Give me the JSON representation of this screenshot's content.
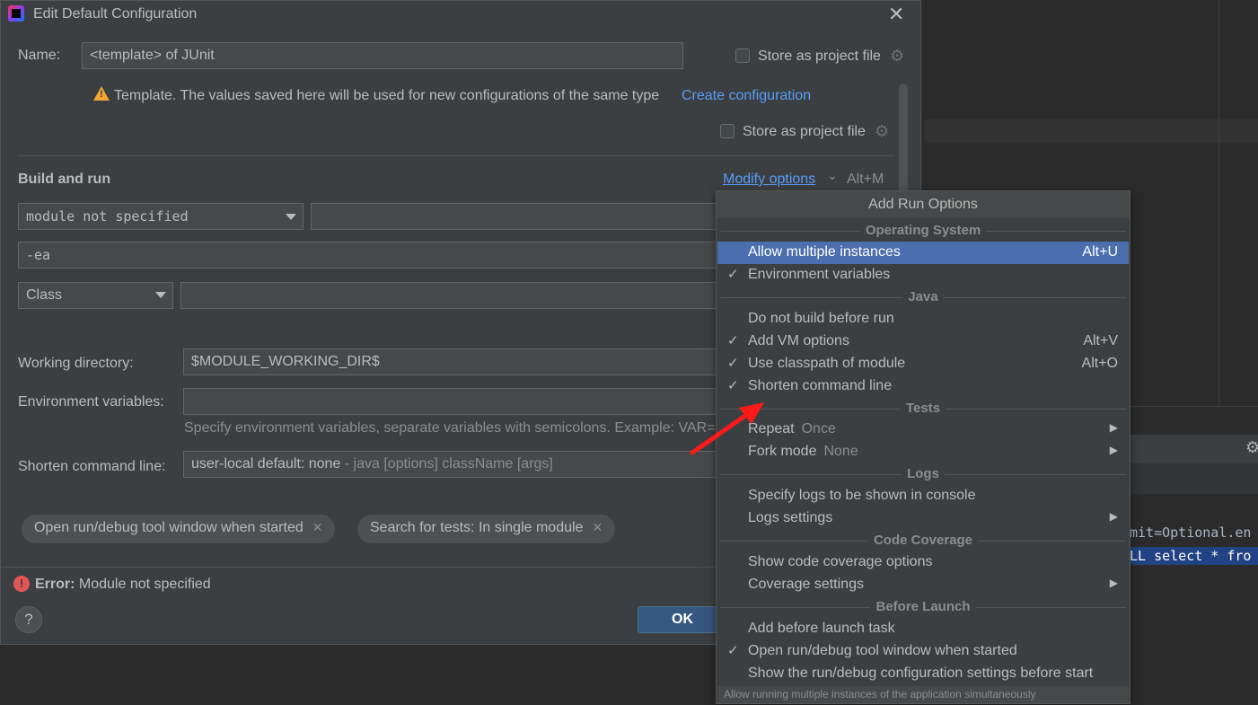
{
  "dialog": {
    "title": "Edit Default Configuration",
    "name_label": "Name:",
    "name_value": "<template> of JUnit",
    "store_label": "Store as project file",
    "warning_text": "Template. The values saved here will be used for new configurations of the same type",
    "create_link": "Create configuration",
    "store_label_2": "Store as project file",
    "section_title": "Build and run",
    "modify_options": "Modify options",
    "modify_shortcut": "Alt+M",
    "module_select": "module not specified",
    "vm_options": "-ea",
    "class_select": "Class",
    "working_dir_label": "Working directory:",
    "working_dir_value": "$MODULE_WORKING_DIR$",
    "env_label": "Environment variables:",
    "env_hint": "Specify environment variables, separate variables with semicolons. Example: VAR=",
    "shorten_label": "Shorten command line:",
    "shorten_value": "user-local default: none",
    "shorten_hint": " - java [options] className [args]",
    "chips": [
      "Open run/debug tool window when started",
      "Search for tests: In single module"
    ],
    "error_label": "Error:",
    "error_text": "Module not specified",
    "help": "?",
    "ok": "OK"
  },
  "popup": {
    "header": "Add Run Options",
    "sections": {
      "os": "Operating System",
      "java": "Java",
      "tests": "Tests",
      "logs": "Logs",
      "coverage": "Code Coverage",
      "before": "Before Launch"
    },
    "items": {
      "allow_multiple": {
        "label": "Allow multiple instances",
        "shortcut": "Alt+U"
      },
      "env_vars": {
        "label": "Environment variables"
      },
      "no_build": {
        "label": "Do not build before run"
      },
      "add_vm": {
        "label": "Add VM options",
        "shortcut": "Alt+V"
      },
      "classpath": {
        "label": "Use classpath of module",
        "shortcut": "Alt+O"
      },
      "shorten": {
        "label": "Shorten command line"
      },
      "repeat": {
        "label": "Repeat",
        "sub": "Once"
      },
      "fork": {
        "label": "Fork mode",
        "sub": "None"
      },
      "logs_console": {
        "label": "Specify logs to be shown in console"
      },
      "logs_settings": {
        "label": "Logs settings"
      },
      "coverage_options": {
        "label": "Show code coverage options"
      },
      "coverage_settings": {
        "label": "Coverage settings"
      },
      "add_before": {
        "label": "Add before launch task"
      },
      "open_tool": {
        "label": "Open run/debug tool window when started"
      },
      "show_settings": {
        "label": "Show the run/debug configuration settings before start"
      }
    },
    "check": "✓",
    "footer": "Allow running multiple instances of the application simultaneously"
  },
  "background": {
    "code_line_1": "mit=Optional.en",
    "code_line_2": "LL select * fro"
  },
  "colors": {
    "accent": "#4b6eaf",
    "link": "#589df6",
    "warning": "#f0a732",
    "error": "#e05555",
    "arrow": "#ff1a1a"
  }
}
